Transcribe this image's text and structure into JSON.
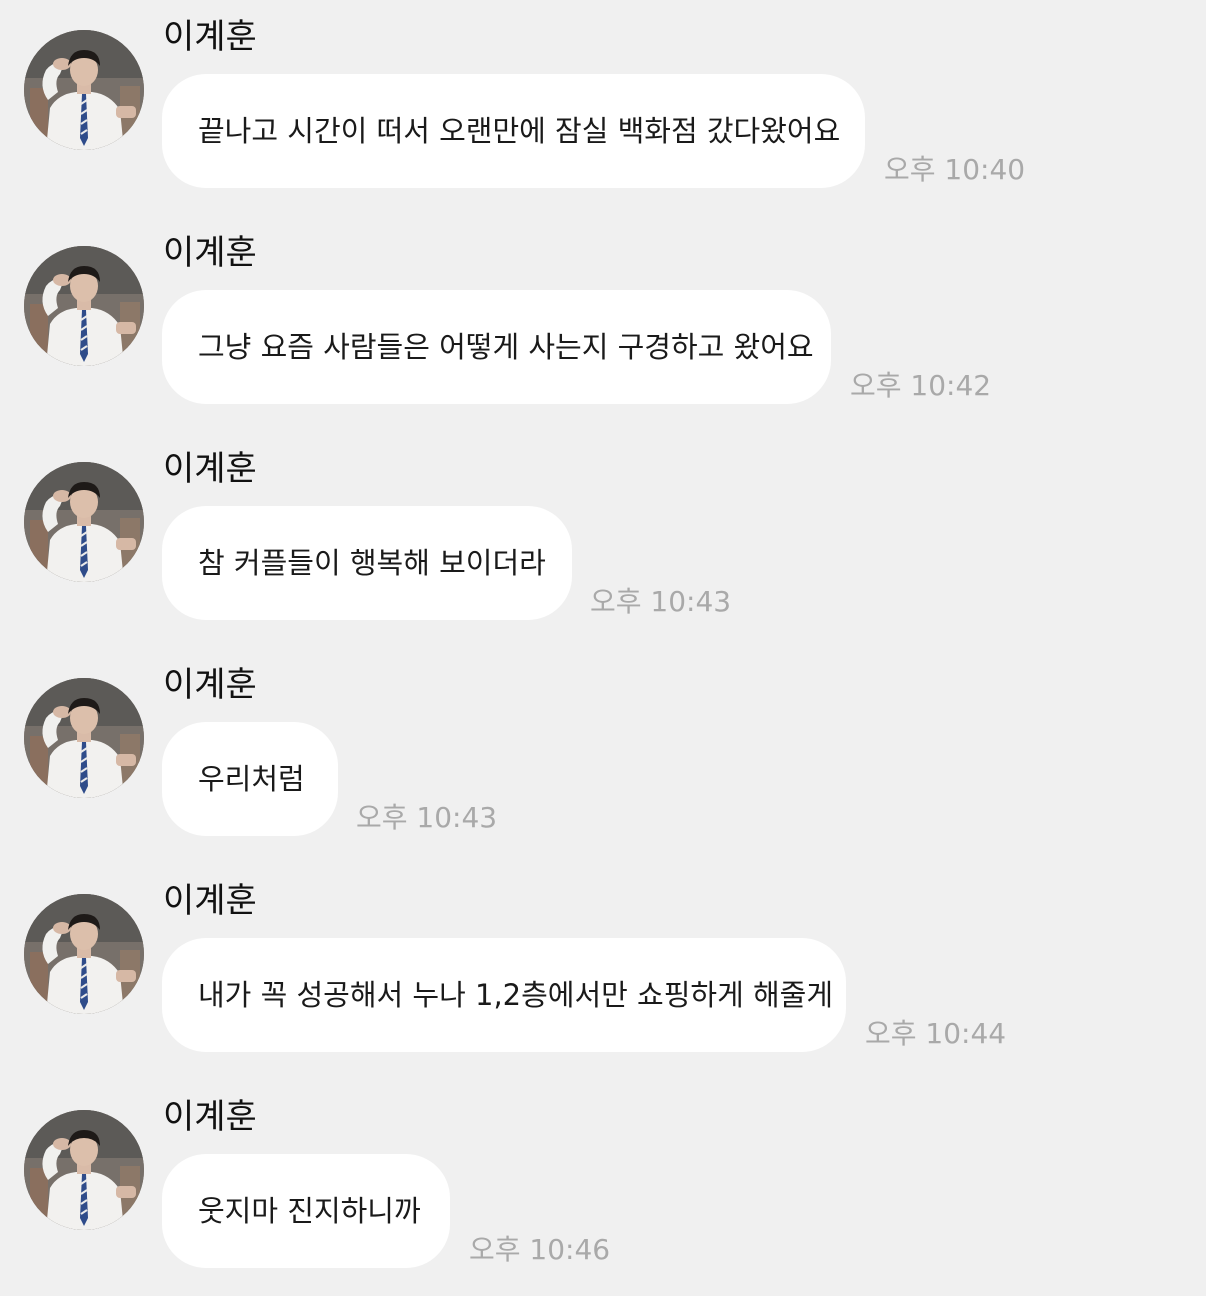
{
  "conversation": {
    "messages": [
      {
        "sender": "이계훈",
        "text": "끝나고 시간이 떠서 오랜만에 잠실 백화점 갔다왔어요",
        "time": "오후 10:40"
      },
      {
        "sender": "이계훈",
        "text": "그냥 요즘 사람들은 어떻게 사는지 구경하고 왔어요",
        "time": "오후 10:42"
      },
      {
        "sender": "이계훈",
        "text": "참 커플들이 행복해 보이더라",
        "time": "오후 10:43"
      },
      {
        "sender": "이계훈",
        "text": "우리처럼",
        "time": "오후 10:43"
      },
      {
        "sender": "이계훈",
        "text": "내가 꼭 성공해서 누나 1,2층에서만 쇼핑하게 해줄게",
        "time": "오후 10:44"
      },
      {
        "sender": "이계훈",
        "text": "웃지마 진지하니까",
        "time": "오후 10:46"
      }
    ]
  },
  "colors": {
    "background": "#f0f0f0",
    "bubble": "#ffffff",
    "message_text": "#1a1a1a",
    "sender_name": "#111111",
    "timestamp": "#a9a9a9"
  },
  "icons": {
    "avatar": "profile-photo"
  }
}
